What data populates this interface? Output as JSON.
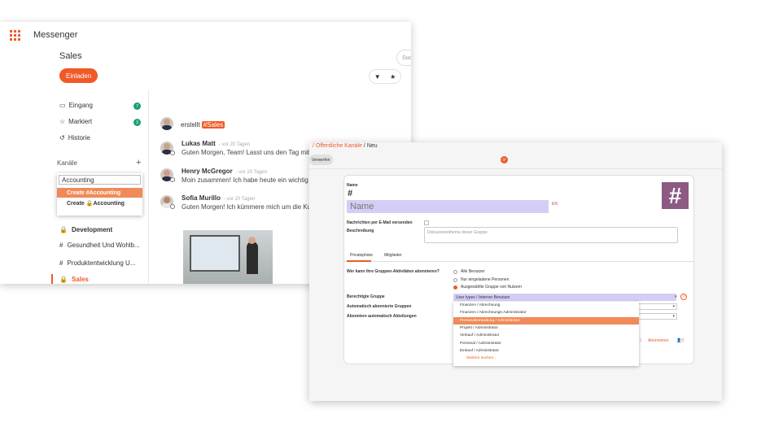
{
  "messenger": {
    "app_title": "Messenger",
    "channel_title": "Sales",
    "invite_label": "Einladen",
    "search_placeholder": "Suc",
    "filter_icon": "filter-icon",
    "star_icon": "star-icon",
    "sidebar": {
      "items": [
        {
          "label": "Eingang",
          "icon": "inbox-icon",
          "badge": "7"
        },
        {
          "label": "Markiert",
          "icon": "star-icon",
          "badge": "3"
        },
        {
          "label": "Historie",
          "icon": "history-icon",
          "badge": ""
        }
      ],
      "channels_label": "Kanäle",
      "add_symbol": "+",
      "search_value": "Accounting",
      "create_public": "Create #Accounting",
      "create_private": "Create 🔒Accounting",
      "channels": [
        {
          "label": "Development",
          "icon": "🔒"
        },
        {
          "label": "Gesundheit Und Wohlb...",
          "icon": "#"
        },
        {
          "label": "Produktentwicklung U...",
          "icon": "#"
        },
        {
          "label": "Sales",
          "icon": "🔒"
        }
      ]
    },
    "messages": {
      "created_text": "erstellt",
      "created_tag": "#Sales",
      "items": [
        {
          "author": "Lukas Matt",
          "date": "- vor 20 Tagen",
          "text": "Guten Morgen, Team! Lasst uns den Tag mit"
        },
        {
          "author": "Henry McGregor",
          "date": "- vor 20 Tagen",
          "text": "Moin zusammen! Ich habe heute ein wichtig"
        },
        {
          "author": "Sofia Murillo",
          "date": "- vor 20 Tagen",
          "text": "Guten Morgen! Ich kümmere mich um die Ku"
        }
      ]
    }
  },
  "form": {
    "breadcrumb": {
      "part1": "/ Öffentliche Kanäle",
      "sep": " / ",
      "current": "Neu"
    },
    "discard_label": "Verwerfen",
    "name_label": "Name",
    "name_prefix": "#",
    "name_placeholder": "Name",
    "required_mark": "EN",
    "avatar_symbol": "#",
    "email_label": "Nachrichten per E-Mail versenden",
    "desc_label": "Beschreibung",
    "desc_placeholder": "Diskussionsthema dieser Gruppe",
    "tabs": [
      "Privatsphäre",
      "Mitglieder"
    ],
    "subscribe_question": "Wer kann ihre Gruppen-Aktivitäten abonnieren?",
    "radio_options": [
      {
        "label": "Alle Benutzer",
        "checked": false
      },
      {
        "label": "Nur eingeladene Personen",
        "checked": false
      },
      {
        "label": "Ausgewählte Gruppe von Nutzern",
        "checked": true
      }
    ],
    "authorized_label": "Berechtigte Gruppe",
    "authorized_value": "User types / Interner Benutzer",
    "auto_groups_label": "Automatisch abonnierte Gruppen",
    "auto_depts_label": "Abonniere automatisch Abteilungen",
    "dropdown": [
      "Finanzen / Abrechnung",
      "Finanzen / Abrechnungs-Administrator",
      "Personalverwaltung / Administrator",
      "Projekt / Administrator",
      "Verkauf / Administrator",
      "Personal / Administrator",
      "Einkauf / Administrator"
    ],
    "dropdown_highlight_index": 2,
    "search_more": "Weitere suchen...",
    "abonnieren_label": "Abonnieren",
    "count_label": "👤0",
    "accent": "#f05a28",
    "avatar_color": "#8c5a82",
    "selection_color": "#d4cdf5"
  }
}
